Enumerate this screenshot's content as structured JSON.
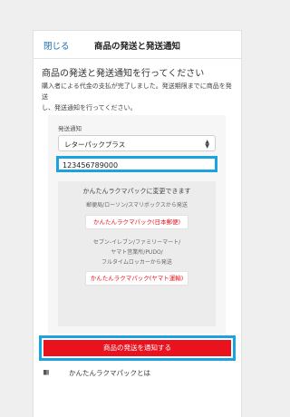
{
  "header": {
    "close_label": "閉じる",
    "title": "商品の発送と発送通知"
  },
  "main": {
    "page_title": "商品の発送と発送通知を行ってください",
    "description_line1": "購入者による代金の支払が完了しました。発送期限までに商品を発送",
    "description_line2": "し、発送通知を行ってください。"
  },
  "form": {
    "field_label": "発送通知",
    "shipping_method": "レターパックプラス",
    "tracking_number": "123456789000"
  },
  "rakuma": {
    "title": "かんたんラクマパックに変更できます",
    "jp_note": "郵便局/ローソン/スマリボックスから発送",
    "jp_button": "かんたんラクマパック(日本郵便)",
    "yamato_note_line1": "セブン-イレブン/ファミリーマート/",
    "yamato_note_line2": "ヤマト営業所/PUDO/",
    "yamato_note_line3": "フルタイムロッカーから発送",
    "yamato_button": "かんたんラクマパック(ヤマト運輸)"
  },
  "actions": {
    "submit_label": "商品の発送を通知する"
  },
  "footer": {
    "link_label": "かんたんラクマパックとは",
    "icon": "book-icon"
  },
  "colors": {
    "accent_red": "#e8131f",
    "link_blue": "#1f6bb8",
    "highlight_blue": "#1aa3e0"
  }
}
